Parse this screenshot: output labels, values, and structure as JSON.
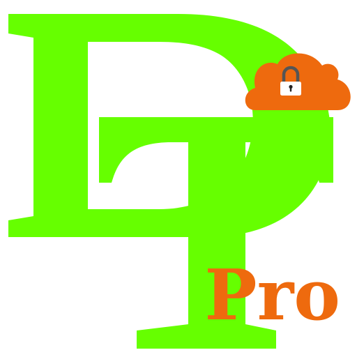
{
  "logo": {
    "monogram_letters": "DT",
    "badge_text": "Pro",
    "icons": [
      "cloud-icon",
      "padlock-icon"
    ]
  },
  "colors": {
    "background": "#ffffff",
    "monogram_green": "#66ff00",
    "accent_orange": "#ee6a0e",
    "lock_body": "#ffffff",
    "lock_shackle": "#555555",
    "keyhole": "#222222"
  }
}
